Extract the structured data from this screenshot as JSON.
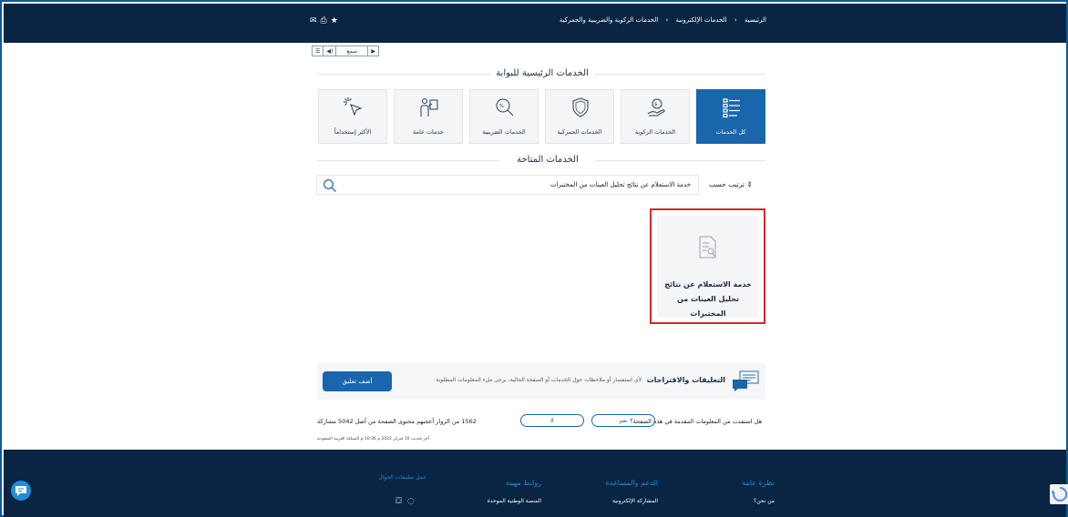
{
  "topbar": {
    "breadcrumbs": [
      "الرئيسية",
      "الخدمات الإلكترونية",
      "الخدمات الزكوية والضريبية والجمركية"
    ],
    "tools": [
      "✉",
      "⎙",
      "★"
    ]
  },
  "audio": {
    "play": "▶",
    "label": "سمع",
    "volume": "◀)",
    "menu": "☰"
  },
  "main_services": {
    "title": "الخدمات الرئيسية للبوابة",
    "tiles": [
      {
        "label": "كل الخدمات",
        "icon": "list-icon",
        "active": true
      },
      {
        "label": "الخدمات الزكوية",
        "icon": "zakat-hand-icon",
        "active": false
      },
      {
        "label": "الخدمات الجمركية",
        "icon": "shield-icon",
        "active": false
      },
      {
        "label": "الخدمات الضريبية",
        "icon": "tax-search-icon",
        "active": false
      },
      {
        "label": "خدمات عامة",
        "icon": "person-board-icon",
        "active": false
      },
      {
        "label": "الأكثر إستخداماً",
        "icon": "cursor-click-icon",
        "active": false
      }
    ]
  },
  "available": {
    "title": "الخدمات المتاحة",
    "sort_label": "⇕ ترتيب حسب",
    "search_value": "خدمة الاستعلام عن نتائج تحليل العينات من المختبرات",
    "card_title": "خدمة الاستعلام عن نتائج تحليل العينات من المختبرات"
  },
  "feedback": {
    "title": "التعليقات والاقتراحات",
    "description": "لأي استفسار أو ملاحظات حول الخدمات أو الصفحة الحالية، يرجى ملء المعلومات المطلوبة",
    "add_button": "أضف تعليق"
  },
  "helpful": {
    "question": "هل استفدت من المعلومات المقدمة في هذه الصفحة؟",
    "yes": "نعم",
    "no": "لا",
    "stats": "1562 من الزوار أعجبهم محتوى الصفحة من أصل 5042 مشاركة",
    "updated": "آخر تحديث 10 فبراير 2022 م 10:36 م المملكة العربية السعودية"
  },
  "footer": {
    "columns": [
      {
        "heading": "نظرة عامة",
        "item": "من نحن؟"
      },
      {
        "heading": "الدعم والمساعدة",
        "item": "المشاركة الإلكترونية"
      },
      {
        "heading": "روابط مهمة",
        "item": "المنصة الوطنية الموحدة"
      },
      {
        "heading": "حمل تطبيقات الجوال",
        "item": ""
      }
    ]
  },
  "colors": {
    "navy": "#0a2444",
    "accent": "#1a66ac",
    "highlight": "#d8262d"
  }
}
